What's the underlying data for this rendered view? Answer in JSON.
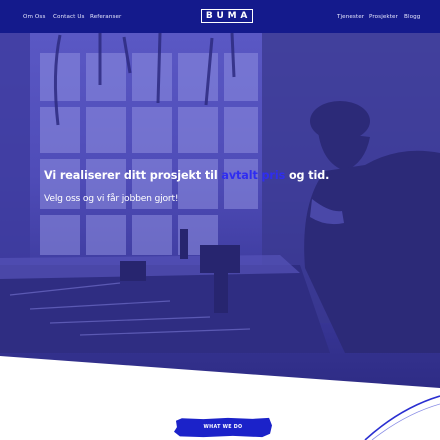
{
  "nav": {
    "left_links": [
      "Om Oss",
      "Contact Us",
      "Referanser"
    ],
    "logo": "BUMA",
    "right_links": [
      "Tjenester",
      "Prosjekter",
      "Blogg"
    ]
  },
  "hero": {
    "headline_before": "Vi realiserer ditt prosjekt til ",
    "headline_highlight": "avtalt pris",
    "headline_after": " og tid.",
    "subline": "Velg oss og vi får jobben gjort!"
  },
  "cta": {
    "label": "WHAT WE DO"
  },
  "colors": {
    "nav_bg": "#141a8c",
    "hero_overlay": "#4f4cb8",
    "highlight": "#2f2df0",
    "cta_bg": "#1b22c9"
  }
}
